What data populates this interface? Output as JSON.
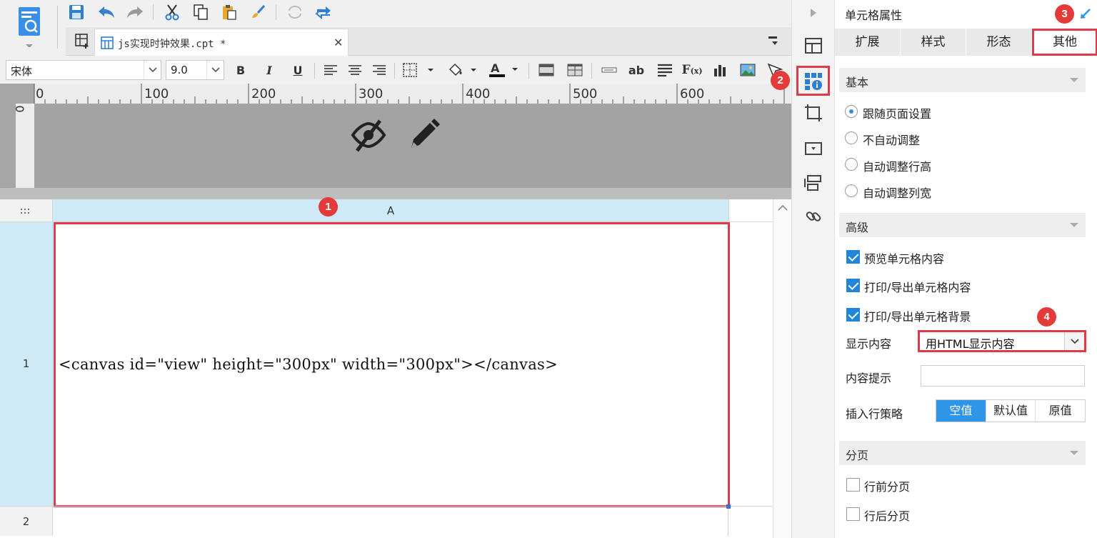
{
  "file_tab": {
    "label": "js实现时钟效果.cpt *"
  },
  "format_bar": {
    "font_name": "宋体",
    "font_size": "9.0"
  },
  "ruler": {
    "ticks": [
      "0",
      "100",
      "200",
      "300",
      "400",
      "500",
      "600"
    ],
    "vertical_tick": "0"
  },
  "grid": {
    "column_a": "A",
    "row_1": "1",
    "row_2": "2",
    "cell_a1_content": "<canvas id=\"view\" height=\"300px\" width=\"300px\"></canvas>"
  },
  "markers": [
    "1",
    "2",
    "3",
    "4"
  ],
  "panel": {
    "title": "单元格属性",
    "tabs": [
      "扩展",
      "样式",
      "形态",
      "其他"
    ],
    "active_tab": "其他",
    "basic": {
      "heading": "基本",
      "options": [
        "跟随页面设置",
        "不自动调整",
        "自动调整行高",
        "自动调整列宽"
      ],
      "selected": "跟随页面设置"
    },
    "advanced": {
      "heading": "高级",
      "checks": [
        "预览单元格内容",
        "打印/导出单元格内容",
        "打印/导出单元格背景"
      ],
      "display_label": "显示内容",
      "display_value": "用HTML显示内容",
      "hint_label": "内容提示",
      "hint_value": "",
      "strategy_label": "插入行策略",
      "strategy_options": [
        "空值",
        "默认值",
        "原值"
      ],
      "strategy_selected": "空值"
    },
    "paging": {
      "heading": "分页",
      "checks": [
        "行前分页",
        "行后分页"
      ]
    }
  },
  "colors": {
    "accent_blue": "#2e95e8",
    "highlight_red": "#e0394a",
    "header_blue": "#cfeaf7"
  }
}
